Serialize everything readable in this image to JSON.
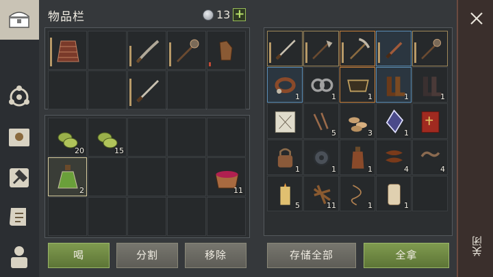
{
  "title": "物品栏",
  "currency": {
    "count": "13",
    "plus": "+"
  },
  "buttons": {
    "drink": "喝",
    "split": "分割",
    "remove": "移除",
    "store_all": "存储全部",
    "take_all": "全拿"
  },
  "close": {
    "label": "关闭"
  },
  "left_items": [
    {
      "name": "chainmail-armor-icon",
      "count": ""
    },
    {
      "name": "curved-sword-icon",
      "count": ""
    },
    {
      "name": "spiked-mace-icon",
      "count": ""
    },
    {
      "name": "leather-gloves-icon",
      "count": ""
    },
    {
      "name": "sword-icon",
      "count": ""
    },
    {
      "name": "herb-bundle-icon",
      "count": "20"
    },
    {
      "name": "herb-bundle-icon",
      "count": "15"
    },
    {
      "name": "potion-bottle-icon",
      "count": "2"
    },
    {
      "name": "berry-bowl-icon",
      "count": "11"
    }
  ],
  "right_items": [
    {
      "name": "sword-icon",
      "count": ""
    },
    {
      "name": "halberd-icon",
      "count": ""
    },
    {
      "name": "pickaxe-icon",
      "count": ""
    },
    {
      "name": "dagger-icon",
      "count": ""
    },
    {
      "name": "spiked-mace-icon",
      "count": ""
    },
    {
      "name": "leather-collar-icon",
      "count": "1"
    },
    {
      "name": "shackles-icon",
      "count": "1"
    },
    {
      "name": "tray-icon",
      "count": "1"
    },
    {
      "name": "leather-boots-icon",
      "count": "1"
    },
    {
      "name": "dark-boots-icon",
      "count": "1"
    },
    {
      "name": "blueprint-scroll-icon",
      "count": ""
    },
    {
      "name": "nails-icon",
      "count": "5"
    },
    {
      "name": "wood-chips-icon",
      "count": "3"
    },
    {
      "name": "crystal-icon",
      "count": "1"
    },
    {
      "name": "red-book-icon",
      "count": ""
    },
    {
      "name": "padlock-icon",
      "count": "1"
    },
    {
      "name": "gear-mechanism-icon",
      "count": "1"
    },
    {
      "name": "bottle-icon",
      "count": "1"
    },
    {
      "name": "leather-strip-icon",
      "count": "4"
    },
    {
      "name": "chain-icon",
      "count": "4"
    },
    {
      "name": "candle-icon",
      "count": "5"
    },
    {
      "name": "rope-bundle-icon",
      "count": "11"
    },
    {
      "name": "whip-icon",
      "count": "1"
    },
    {
      "name": "scroll-roll-icon",
      "count": "1"
    }
  ],
  "colors": {
    "accent_green": "#7f9a4f",
    "panel": "#2c2f31",
    "durability": "#b89a68"
  }
}
